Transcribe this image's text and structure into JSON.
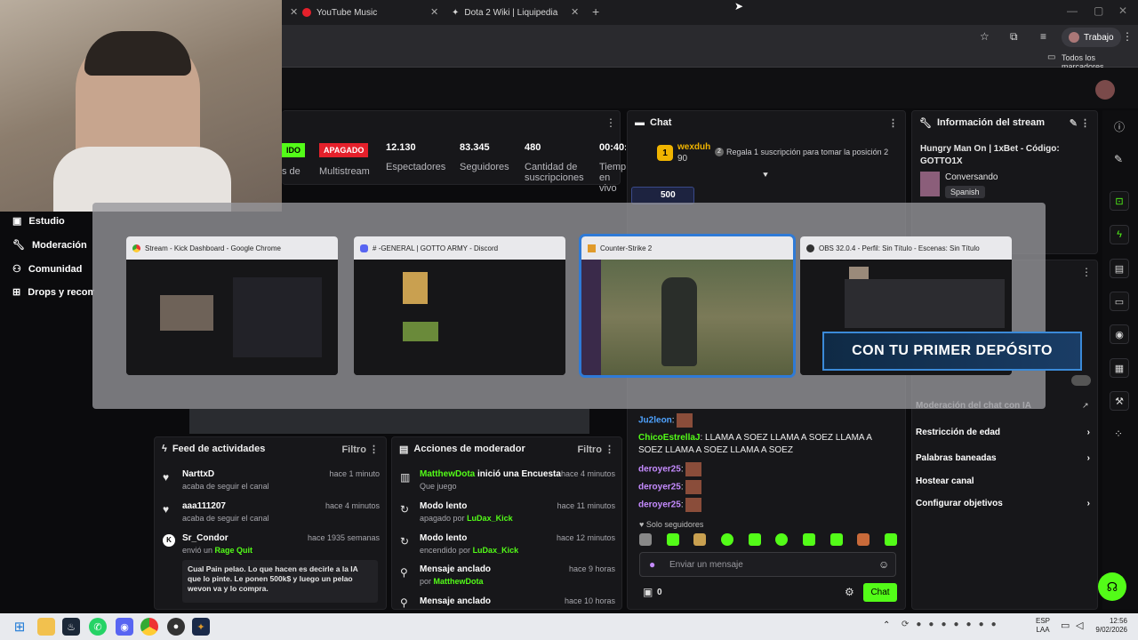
{
  "browser": {
    "tabs": [
      {
        "label": "YouTube Music",
        "icon": "youtube-music-icon"
      },
      {
        "label": "Dota 2 Wiki | Liquipedia",
        "icon": "liquipedia-icon"
      }
    ],
    "new_tab": "+",
    "profile_label": "Trabajo",
    "bookmarks_all": "Todos los marcadores"
  },
  "stream_stats": {
    "status_badge": "IDO",
    "multistream_badge": "APAGADO",
    "multistream_label": "Multistream",
    "partial_label": "s de",
    "viewers": {
      "value": "12.130",
      "label": "Espectadores"
    },
    "followers": {
      "value": "83.345",
      "label": "Seguidores"
    },
    "subs": {
      "value": "480",
      "label": "Cantidad de suscripciones"
    },
    "live": {
      "value": "00:40:",
      "label": "Tiempo en vivo"
    }
  },
  "sidebar": {
    "items": [
      {
        "label": "Estudio",
        "icon": "studio-icon"
      },
      {
        "label": "Moderación",
        "icon": "wrench-icon"
      },
      {
        "label": "Comunidad",
        "icon": "community-icon"
      },
      {
        "label": "Drops y recom",
        "icon": "drops-icon"
      }
    ]
  },
  "chat": {
    "title": "Chat",
    "leader_name": "wexduh",
    "leader_amount": "90",
    "leader_rank": "1",
    "gift_prompt": "Regala 1 suscripción para tomar la posición 2",
    "gift_rank": "2",
    "pinned_amount": "500",
    "messages": [
      {
        "user": "Ju2leon",
        "text": ":",
        "color": "#4fa3ff"
      },
      {
        "user": "ChicoEstrellaJ",
        "text": ": LLAMA A SOEZ   LLAMA A SOEZ   LLAMA A SOEZ   LLAMA A SOEZ   LLAMA A SOEZ",
        "color": "#53fc18"
      },
      {
        "user": "deroyer25",
        "text": ":",
        "color": "#c58bff"
      },
      {
        "user": "deroyer25",
        "text": ":",
        "color": "#c58bff"
      },
      {
        "user": "deroyer25",
        "text": ":",
        "color": "#c58bff"
      }
    ],
    "followers_only": "Solo seguidores",
    "input_placeholder": "Enviar un mensaje",
    "points": "0",
    "send_label": "Chat"
  },
  "stream_info": {
    "title": "Información del stream",
    "stream_title": "Hungry Man On | 1xBet - Código: GOTTO1X",
    "category": "Conversando",
    "language": "Spanish"
  },
  "moderation_settings": {
    "partial_row": "Moderación del chat con IA",
    "rows": [
      "Restricción de edad",
      "Palabras baneadas",
      "Hostear canal",
      "Configurar objetivos"
    ]
  },
  "activity_feed": {
    "title": "Feed de actividades",
    "filter": "Filtro",
    "items": [
      {
        "name": "NarttxD",
        "sub": "acaba de seguir el canal",
        "time": "hace 1 minuto",
        "icon": "heart-icon"
      },
      {
        "name": "aaa111207",
        "sub": "acaba de seguir el canal",
        "time": "hace 4 minutos",
        "icon": "heart-icon"
      },
      {
        "name": "Sr_Condor",
        "sub": "envió un",
        "sub_highlight": "Rage Quit",
        "time": "hace 1935 semanas",
        "icon": "kick-icon"
      }
    ],
    "message": "Cual Pain pelao. Lo que hacen es decirle a la IA que lo pinte. Le ponen 500k$ y luego un pelao wevon va y lo compra."
  },
  "mod_actions": {
    "title": "Acciones de moderador",
    "filter": "Filtro",
    "items": [
      {
        "name": "MatthewDota",
        "action": "inició una Encuesta",
        "sub": "Que juego",
        "time": "hace 4 minutos",
        "icon": "poll-icon"
      },
      {
        "name": "Modo lento",
        "action": "",
        "sub": "apagado por",
        "by": "LuDax_Kick",
        "time": "hace 11 minutos",
        "icon": "slow-icon"
      },
      {
        "name": "Modo lento",
        "action": "",
        "sub": "encendido por",
        "by": "LuDax_Kick",
        "time": "hace 12 minutos",
        "icon": "slow-icon"
      },
      {
        "name": "Mensaje anclado",
        "action": "",
        "sub": "por",
        "by": "MatthewDota",
        "time": "hace 9 horas",
        "icon": "pin-icon"
      },
      {
        "name": "Mensaje anclado",
        "action": "",
        "sub": "",
        "by": "",
        "time": "hace 10 horas",
        "icon": "pin-icon"
      }
    ]
  },
  "switcher": {
    "windows": [
      {
        "title": "Stream - Kick Dashboard - Google Chrome",
        "icon": "chrome-icon"
      },
      {
        "title": "#  -GENERAL | GOTTO ARMY - Discord",
        "icon": "discord-icon"
      },
      {
        "title": "Counter-Strike 2",
        "icon": "cs2-icon"
      },
      {
        "title": "OBS 32.0.4 - Perfil: Sin Título - Escenas: Sin Título",
        "icon": "obs-icon"
      }
    ]
  },
  "overlay_banner": "CON TU PRIMER DEPÓSITO",
  "taskbar": {
    "lang": "ESP",
    "lang2": "LAA",
    "time": "12:56",
    "date": "9/02/2026"
  },
  "colors": {
    "accent": "#53fc18",
    "danger": "#e5202b",
    "bg": "#0b0b0d",
    "panel": "#17171a"
  }
}
